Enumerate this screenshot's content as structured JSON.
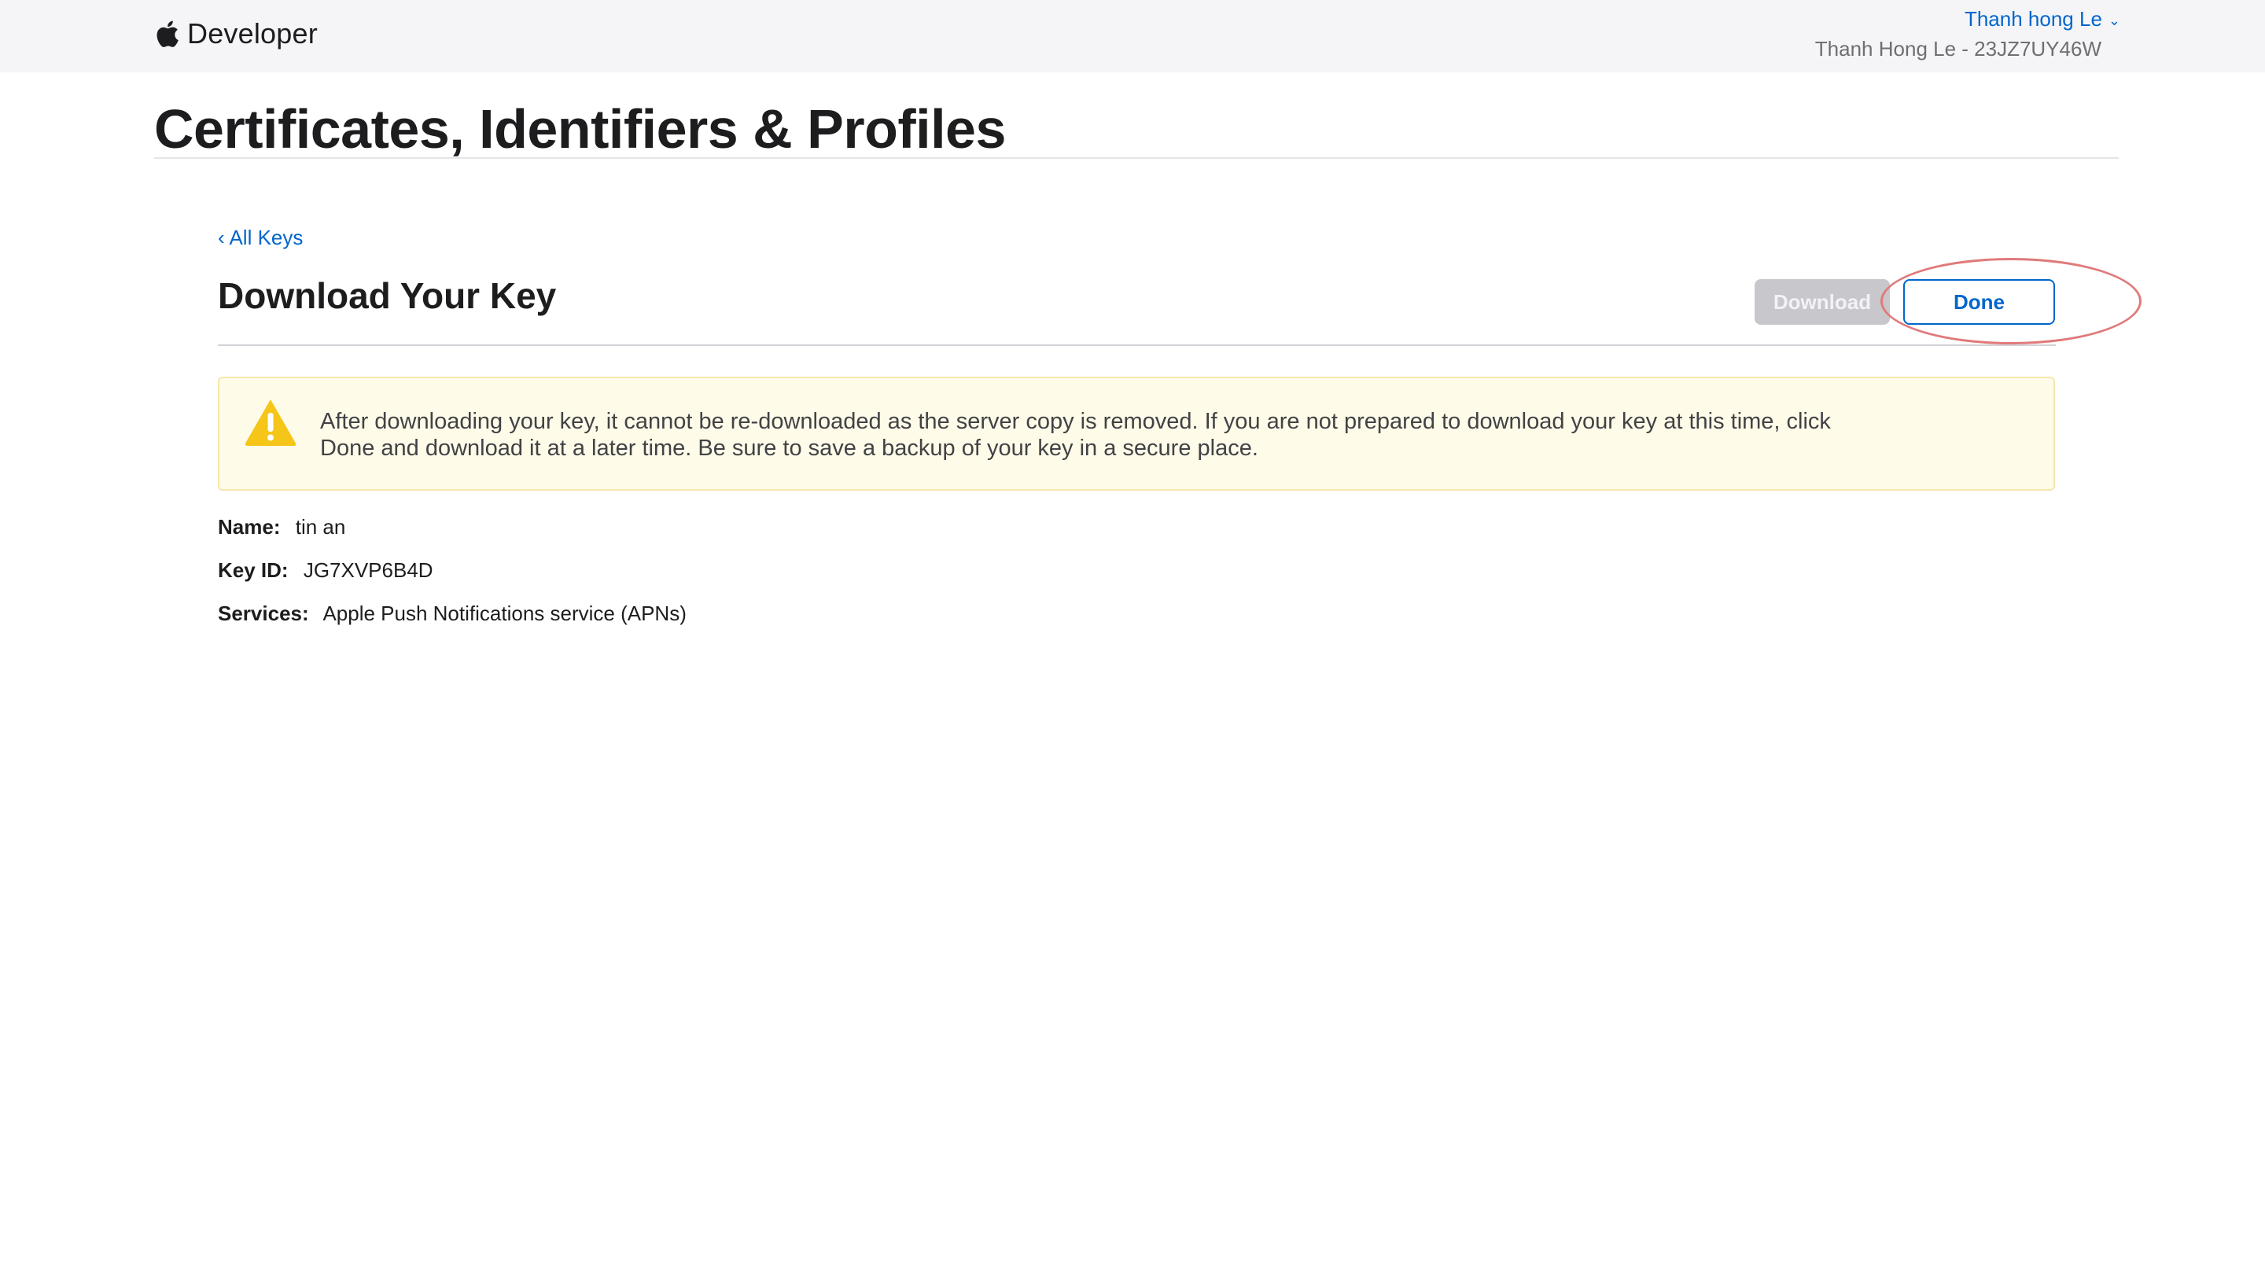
{
  "header": {
    "brand": "Developer",
    "logo_icon": "apple-logo-icon",
    "account_name": "Thanh hong Le",
    "account_team": "Thanh Hong Le - 23JZ7UY46W"
  },
  "page": {
    "title": "Certificates, Identifiers & Profiles"
  },
  "content": {
    "back_link": "‹ All Keys",
    "section_title": "Download Your Key",
    "buttons": {
      "download": "Download",
      "done": "Done"
    },
    "warning": {
      "icon": "warning-triangle-icon",
      "text": "After downloading your key, it cannot be re-downloaded as the server copy is removed. If you are not prepared to download your key at this time, click Done and download it at a later time. Be sure to save a backup of your key in a secure place."
    },
    "details": [
      {
        "label": "Name:",
        "value": "tin an"
      },
      {
        "label": "Key ID:",
        "value": "JG7XVP6B4D"
      },
      {
        "label": "Services:",
        "value": "Apple Push Notifications service (APNs)"
      }
    ]
  },
  "colors": {
    "link": "#0066cc",
    "warning_bg": "#fffbe9",
    "warning_icon": "#f5c518",
    "disabled_button": "#c7c7cc",
    "highlight_ring": "#e07a7a"
  }
}
